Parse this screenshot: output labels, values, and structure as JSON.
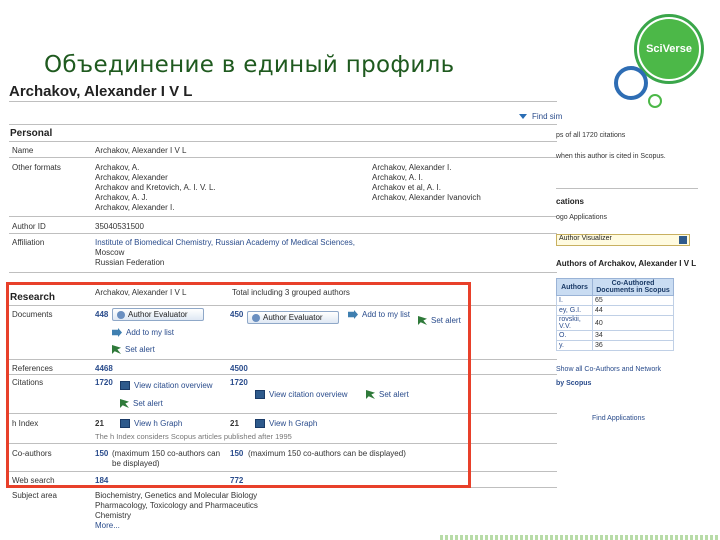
{
  "slide_title": "Объединение в единый профиль",
  "logo_text": "SciVerse",
  "author_heading": "Archakov, Alexander I V L",
  "find_link": "Find sim",
  "personal": {
    "heading": "Personal",
    "name_label": "Name",
    "name_value": "Archakov, Alexander I V L",
    "other_label": "Other formats",
    "other_left": [
      "Archakov, A.",
      "Archakov, Alexander",
      "Archakov and Kretovich, A. I. V. L.",
      "Archakov, A. J.",
      "Archakov, Alexander I."
    ],
    "other_right": [
      "Archakov, Alexander I.",
      "Archakov, A. I.",
      "Archakov et al, A. I.",
      "Archakov, Alexander Ivanovich"
    ],
    "id_label": "Author ID",
    "id_value": "35040531500",
    "aff_label": "Affiliation",
    "aff_lines": [
      "Institute of Biomedical Chemistry, Russian Academy of Medical Sciences,",
      "Moscow",
      "Russian Federation"
    ]
  },
  "research": {
    "heading": "Research",
    "col1_head": "Archakov, Alexander I V L",
    "col2_head": "Total including 3 grouped authors",
    "documents_label": "Documents",
    "documents_1": "448",
    "documents_2": "450",
    "evaluator_1": "Author Evaluator",
    "evaluator_2": "Author Evaluator",
    "add_list": "Add to my list",
    "set_alert": "Set alert",
    "references_label": "References",
    "references_1": "4468",
    "references_2": "4500",
    "citations_label": "Citations",
    "citations_1": "1720",
    "citations_2": "1720",
    "view_citation": "View citation overview",
    "hindex_label": "h Index",
    "hindex_1": "21",
    "hindex_2": "21",
    "view_graph": "View h Graph",
    "hindex_note": "The h Index considers Scopus articles published after 1995",
    "coauthors_label": "Co-authors",
    "coauthors_1": "150",
    "coauthors_note_1": "(maximum 150 co-authors can be displayed)",
    "coauthors_2": "150",
    "coauthors_note_2": "(maximum 150 co-authors can be displayed)",
    "websearch_label": "Web search",
    "websearch_1": "184",
    "websearch_2": "772",
    "subject_label": "Subject area",
    "subject_lines": [
      "Biochemistry, Genetics and Molecular Biology",
      "Pharmacology, Toxicology and Pharmaceutics",
      "Chemistry",
      "More..."
    ]
  },
  "right_panel": {
    "line1": "ps of all 1720 citations",
    "line2": "when this author is cited in Scopus.",
    "head1": "cations",
    "line3": "ogo Applications",
    "select_value": "Author Visualizer",
    "head2": "Authors of Archakov, Alexander I V L",
    "table_head_1": "Authors",
    "table_head_2": "Co-Authored Documents in Scopus",
    "table_rows": [
      [
        "I.",
        "65"
      ],
      [
        "ey, G.I.",
        "44"
      ],
      [
        "rovskii, V.V.",
        "40"
      ],
      [
        "O.",
        "34"
      ],
      [
        "y.",
        "36"
      ]
    ],
    "line4": "Show all Co-Authors and Network",
    "line5": "by Scopus",
    "line6": "Find Applications"
  },
  "colors": {
    "title_green": "#1f5a1f",
    "accent_red": "#e8402a",
    "link_blue": "#2a4c8c",
    "logo_green": "#4cb848"
  }
}
